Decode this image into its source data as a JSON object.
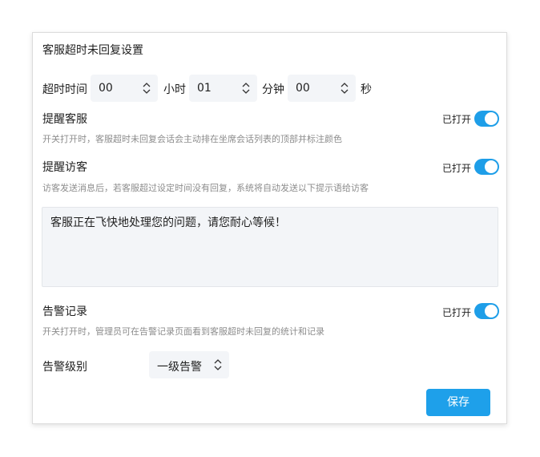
{
  "dialog": {
    "title": "客服超时未回复设置"
  },
  "timeout": {
    "label": "超时时间",
    "hours_value": "00",
    "hours_unit": "小时",
    "minutes_value": "01",
    "minutes_unit": "分钟",
    "seconds_value": "00",
    "seconds_unit": "秒"
  },
  "remind_agent": {
    "title": "提醒客服",
    "status": "已打开",
    "enabled": true,
    "description": "开关打开时，客服超时未回复会话会主动排在坐席会话列表的顶部并标注颜色"
  },
  "remind_visitor": {
    "title": "提醒访客",
    "status": "已打开",
    "enabled": true,
    "description": "访客发送消息后，若客服超过设定时间没有回复，系统将自动发送以下提示语给访客",
    "message": "客服正在飞快地处理您的问题，请您耐心等候！"
  },
  "alarm_record": {
    "title": "告警记录",
    "status": "已打开",
    "enabled": true,
    "description": "开关打开时，管理员可在告警记录页面看到客服超时未回复的统计和记录"
  },
  "alarm_level": {
    "label": "告警级别",
    "value": "一级告警"
  },
  "actions": {
    "save_label": "保存"
  },
  "colors": {
    "accent": "#1e9ee8",
    "field_bg": "#f3f5f8",
    "muted_text": "#8c8c8c"
  }
}
